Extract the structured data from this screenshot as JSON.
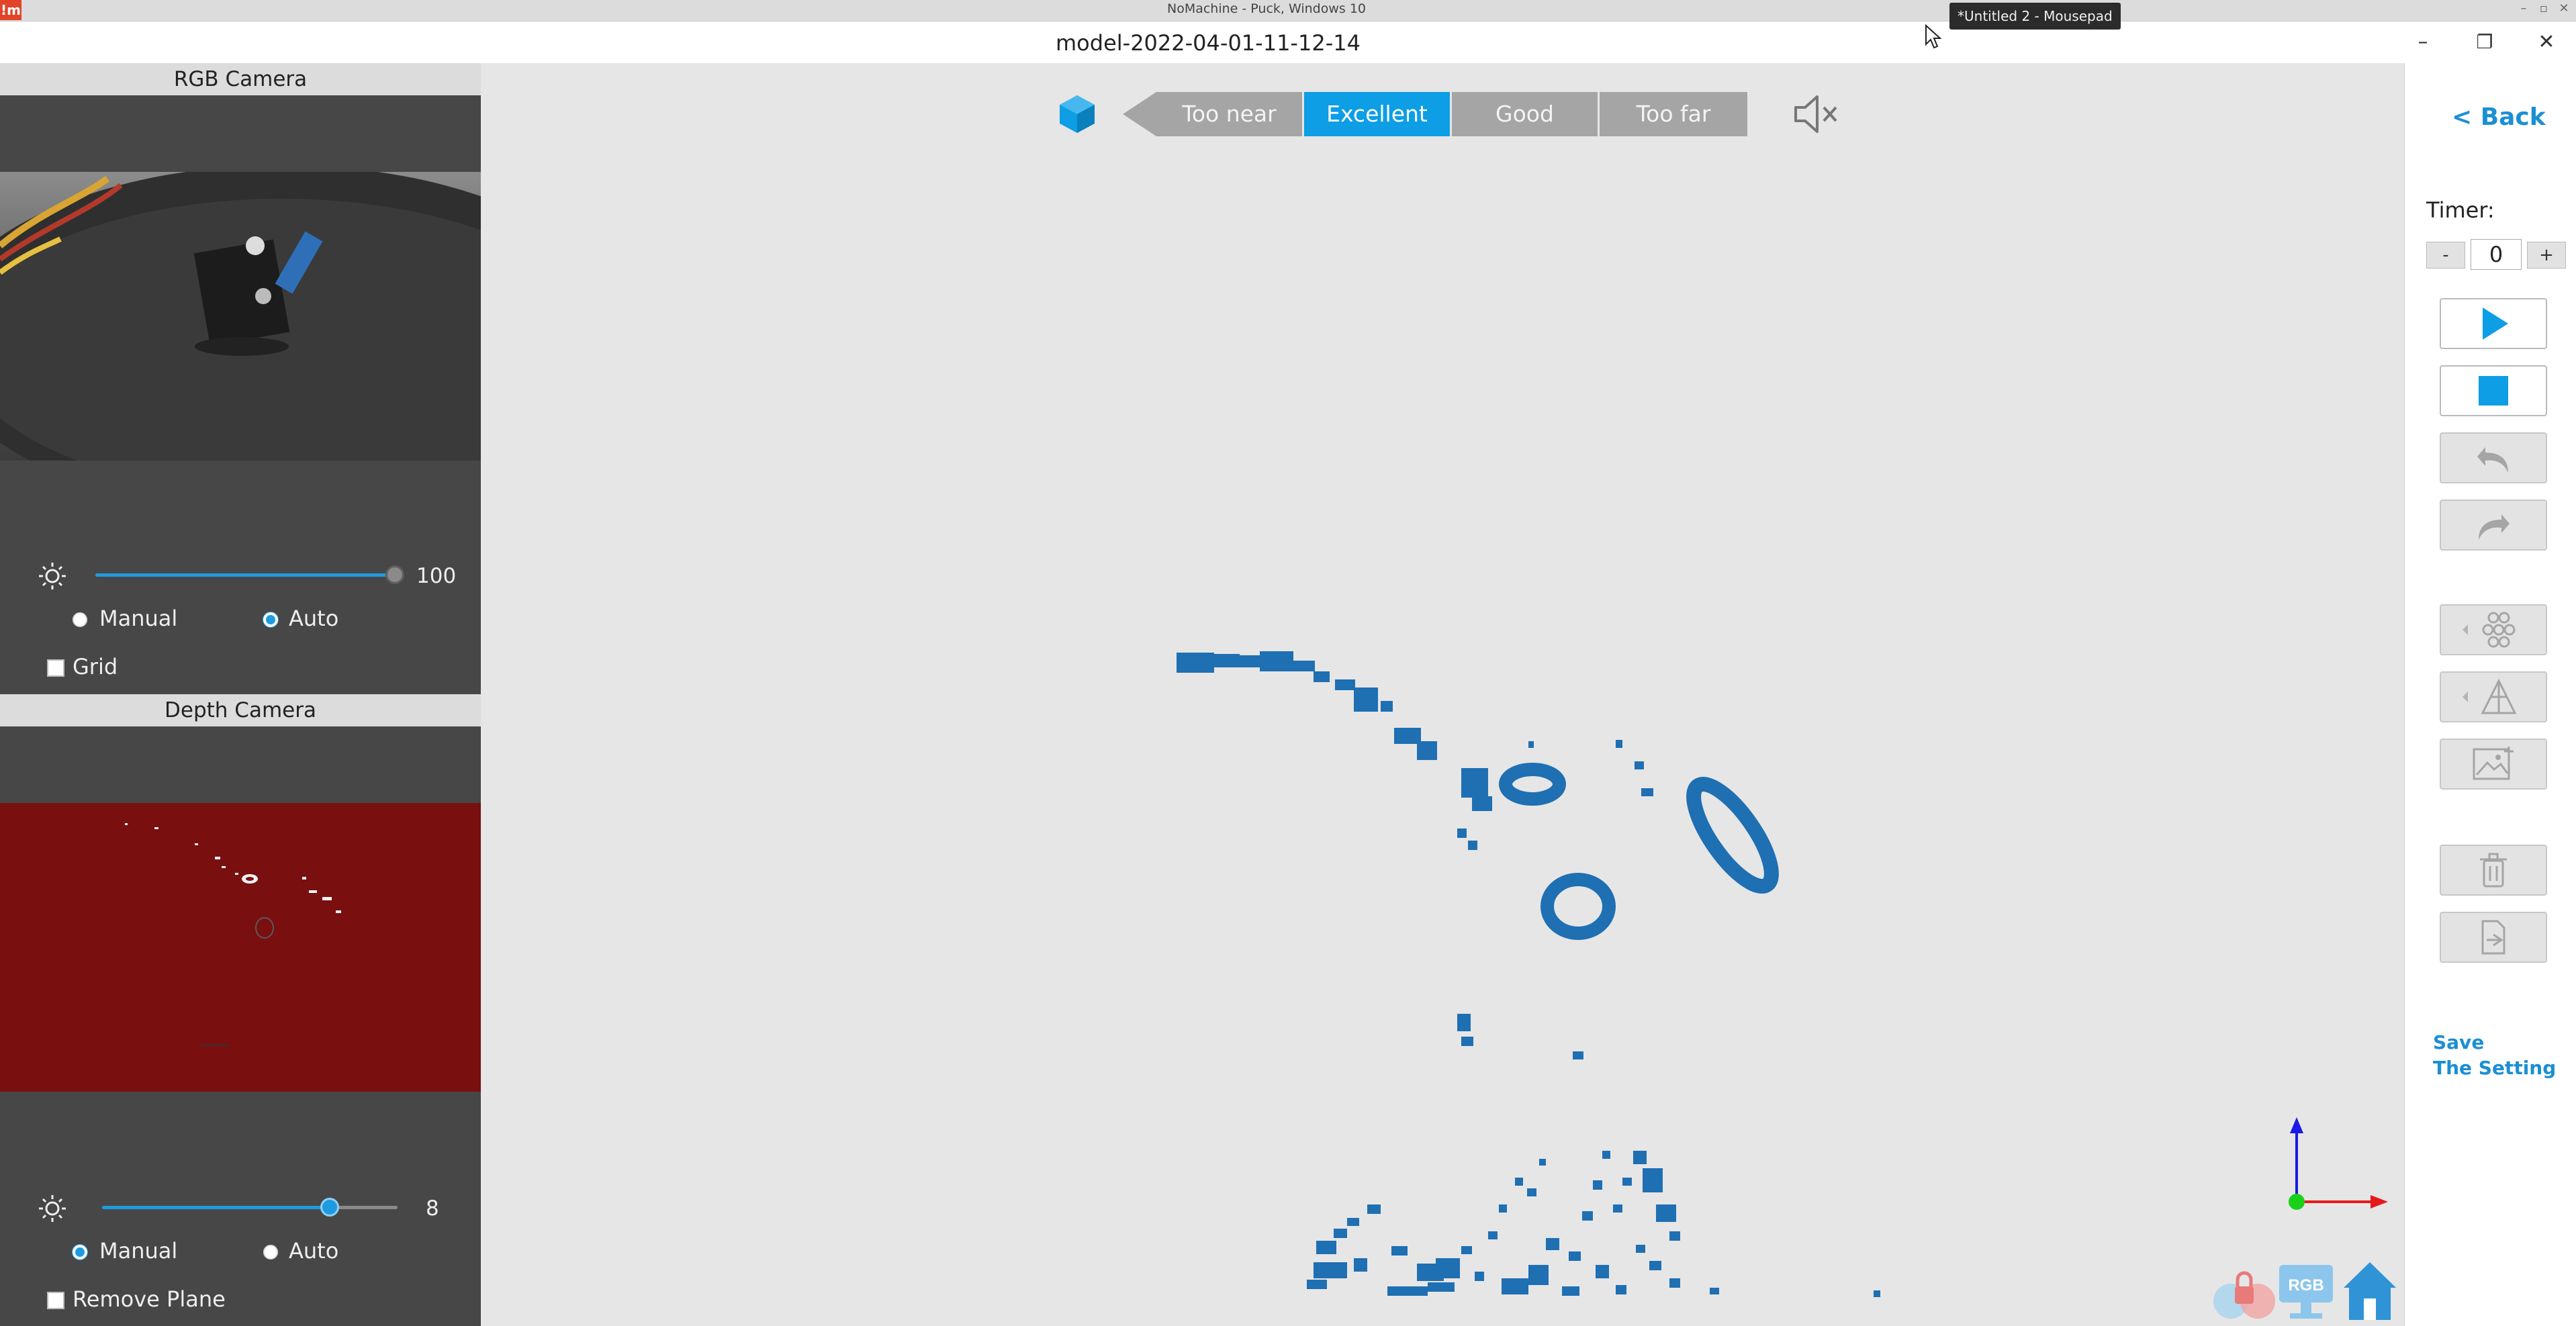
{
  "nomachine": {
    "title": "NoMachine - Puck, Windows 10",
    "logo": "!m",
    "controls": [
      "–",
      "▫",
      "✕"
    ]
  },
  "tooltip": "*Untitled 2 - Mousepad",
  "window": {
    "title": "model-2022-04-01-11-12-14",
    "controls": {
      "minimize": "–",
      "maximize": "❐",
      "close": "✕"
    }
  },
  "left_panel": {
    "rgb_camera": {
      "header": "RGB Camera",
      "exposure": {
        "icon": "brightness-icon",
        "value": 100,
        "fraction": 1.0
      },
      "mode": {
        "manual_label": "Manual",
        "auto_label": "Auto",
        "selected": "Auto"
      },
      "grid": {
        "label": "Grid",
        "checked": false
      }
    },
    "depth_camera": {
      "header": "Depth Camera",
      "exposure": {
        "icon": "brightness-icon",
        "value": 8,
        "fraction": 0.77
      },
      "mode": {
        "manual_label": "Manual",
        "auto_label": "Auto",
        "selected": "Manual"
      },
      "remove_plane": {
        "label": "Remove Plane",
        "checked": false
      }
    }
  },
  "quality_bar": {
    "segments": [
      "Too near",
      "Excellent",
      "Good",
      "Too far"
    ],
    "active": "Excellent",
    "icons": {
      "model": "cube-icon",
      "sound": "mute-icon"
    }
  },
  "right_panel": {
    "back_label": "< Back",
    "timer_label": "Timer:",
    "timer_value": "0",
    "timer_minus": "-",
    "timer_plus": "+",
    "tools": [
      "play-icon",
      "stop-icon",
      "undo-icon",
      "redo-icon",
      "point-cloud-icon",
      "mesh-icon",
      "texture-icon",
      "delete-icon",
      "export-icon"
    ],
    "save_setting_lines": [
      "Save",
      "The Setting"
    ]
  },
  "viewport": {
    "axes": [
      "y-axis",
      "x-axis",
      "z-axis"
    ],
    "bottom_icons": [
      "lock-icon",
      "rgb-display-icon",
      "home-icon"
    ],
    "rgb_badge": "RGB",
    "point_color": "#1f6fb3"
  },
  "colors": {
    "accent": "#0d9ee5",
    "link": "#1b8fd3",
    "panel_bg": "#474747",
    "viewport_bg": "#e6e6e6",
    "depth_bg": "#7a0f10"
  }
}
